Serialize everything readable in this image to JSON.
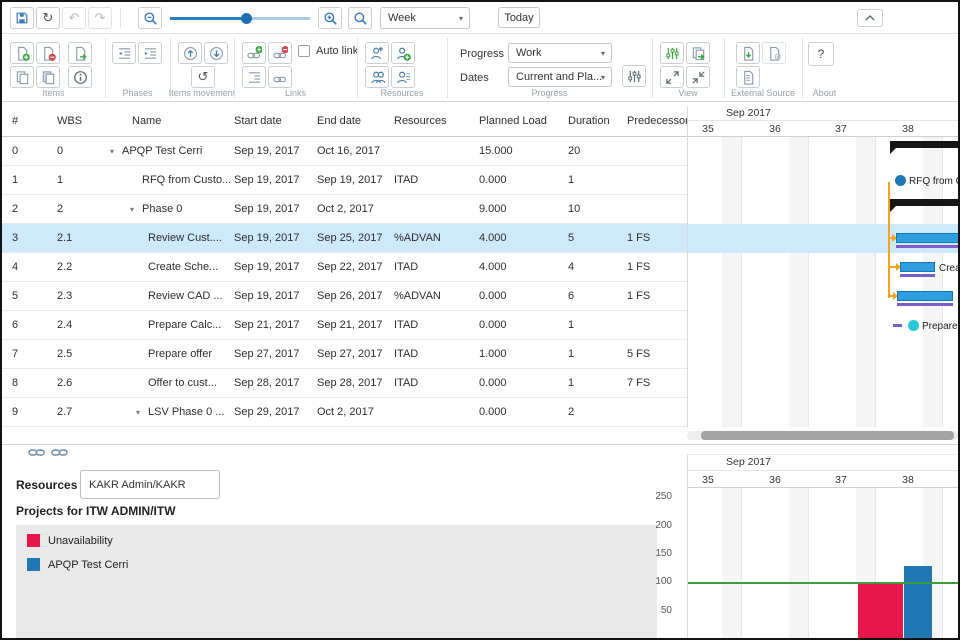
{
  "topbar": {
    "time_scale": "Week",
    "today": "Today"
  },
  "icons": {
    "caret_down": "▾",
    "refresh": "↻",
    "undo": "↶",
    "redo": "↷",
    "loop": "↺"
  },
  "ribbon": {
    "auto_link": "Auto link",
    "progress_label": "Progress",
    "progress_value": "Work",
    "dates_label": "Dates",
    "dates_value": "Current and Pla...",
    "help": "?",
    "groups": {
      "items": "Items",
      "phases": "Phases",
      "movement": "Items movement",
      "links": "Links",
      "resources": "Resources",
      "progress": "Progress",
      "view": "View",
      "external": "External Source",
      "about": "About"
    }
  },
  "table": {
    "columns": [
      "#",
      "WBS",
      "Name",
      "Start date",
      "End date",
      "Resources",
      "Planned Load",
      "Duration",
      "Predecessors"
    ],
    "rows": [
      {
        "num": "0",
        "wbs": "0",
        "name": "APQP Test Cerri",
        "start": "Sep 19, 2017",
        "end": "Oct 16, 2017",
        "res": "",
        "load": "15.000",
        "dur": "20",
        "pred": ""
      },
      {
        "num": "1",
        "wbs": "1",
        "name": "RFQ from Custo...",
        "start": "Sep 19, 2017",
        "end": "Sep 19, 2017",
        "res": "ITAD",
        "load": "0.000",
        "dur": "1",
        "pred": ""
      },
      {
        "num": "2",
        "wbs": "2",
        "name": "Phase 0",
        "start": "Sep 19, 2017",
        "end": "Oct 2, 2017",
        "res": "",
        "load": "9.000",
        "dur": "10",
        "pred": ""
      },
      {
        "num": "3",
        "wbs": "2.1",
        "name": "Review Cust....",
        "start": "Sep 19, 2017",
        "end": "Sep 25, 2017",
        "res": "%ADVAN",
        "load": "4.000",
        "dur": "5",
        "pred": "1 FS"
      },
      {
        "num": "4",
        "wbs": "2.2",
        "name": "Create Sche...",
        "start": "Sep 19, 2017",
        "end": "Sep 22, 2017",
        "res": "ITAD",
        "load": "4.000",
        "dur": "4",
        "pred": "1 FS"
      },
      {
        "num": "5",
        "wbs": "2.3",
        "name": "Review CAD ...",
        "start": "Sep 19, 2017",
        "end": "Sep 26, 2017",
        "res": "%ADVAN",
        "load": "0.000",
        "dur": "6",
        "pred": "1 FS"
      },
      {
        "num": "6",
        "wbs": "2.4",
        "name": "Prepare Calc...",
        "start": "Sep 21, 2017",
        "end": "Sep 21, 2017",
        "res": "ITAD",
        "load": "0.000",
        "dur": "1",
        "pred": ""
      },
      {
        "num": "7",
        "wbs": "2.5",
        "name": "Prepare offer",
        "start": "Sep 27, 2017",
        "end": "Sep 27, 2017",
        "res": "ITAD",
        "load": "1.000",
        "dur": "1",
        "pred": "5 FS"
      },
      {
        "num": "8",
        "wbs": "2.6",
        "name": "Offer to cust...",
        "start": "Sep 28, 2017",
        "end": "Sep 28, 2017",
        "res": "ITAD",
        "load": "0.000",
        "dur": "1",
        "pred": "7 FS"
      },
      {
        "num": "9",
        "wbs": "2.7",
        "name": "LSV Phase 0 ...",
        "start": "Sep 29, 2017",
        "end": "Oct 2, 2017",
        "res": "",
        "load": "0.000",
        "dur": "2",
        "pred": ""
      }
    ]
  },
  "gantt": {
    "month": "Sep 2017",
    "weeks": [
      "35",
      "36",
      "37",
      "38"
    ],
    "labels": {
      "rfq": "RFQ from C...",
      "create": "Creat...",
      "prepare": "Prepare..."
    },
    "bars": [
      {
        "row": 0,
        "type": "summary"
      },
      {
        "row": 1,
        "type": "milestone",
        "label": "RFQ from C..."
      },
      {
        "row": 2,
        "type": "summary"
      },
      {
        "row": 3,
        "type": "task",
        "selected": true
      },
      {
        "row": 4,
        "type": "task",
        "label": "Creat..."
      },
      {
        "row": 5,
        "type": "task"
      },
      {
        "row": 6,
        "type": "milestone",
        "label": "Prepare..."
      }
    ],
    "colors": {
      "summary": "#161616",
      "task": "#2f9fe0",
      "baseline": "#7b5ec9",
      "milestone": "#1f77b4",
      "milestone_cyan": "#29c7d8",
      "connector": "#f6a21e",
      "selected_row": "#cde9fb"
    }
  },
  "bottom": {
    "resources_label": "Resources",
    "resource_value": "KAKR Admin/KAKR",
    "projects_title": "Projects for ITW ADMIN/ITW",
    "legend": [
      {
        "label": "Unavailability",
        "color": "#e5174b"
      },
      {
        "label": "APQP Test Cerri",
        "color": "#1f77b4"
      }
    ]
  },
  "chart_data": {
    "type": "bar",
    "title": "Projects for ITW ADMIN/ITW",
    "x_month": "Sep 2017",
    "x_weeks": [
      "35",
      "36",
      "37",
      "38"
    ],
    "ylim": [
      0,
      275
    ],
    "yticks": [
      "250",
      "200",
      "150",
      "100",
      "50"
    ],
    "grid": "weekly-vertical",
    "legend_position": "left-panel",
    "reference_line": {
      "value": 100,
      "color": "#3a9c3a"
    },
    "series": [
      {
        "name": "Unavailability",
        "color": "#e5174b",
        "points": [
          {
            "week": "38",
            "value": 100
          }
        ]
      },
      {
        "name": "APQP Test Cerri",
        "color": "#1f77b4",
        "points": [
          {
            "week": "38",
            "value": 130
          }
        ]
      }
    ]
  }
}
